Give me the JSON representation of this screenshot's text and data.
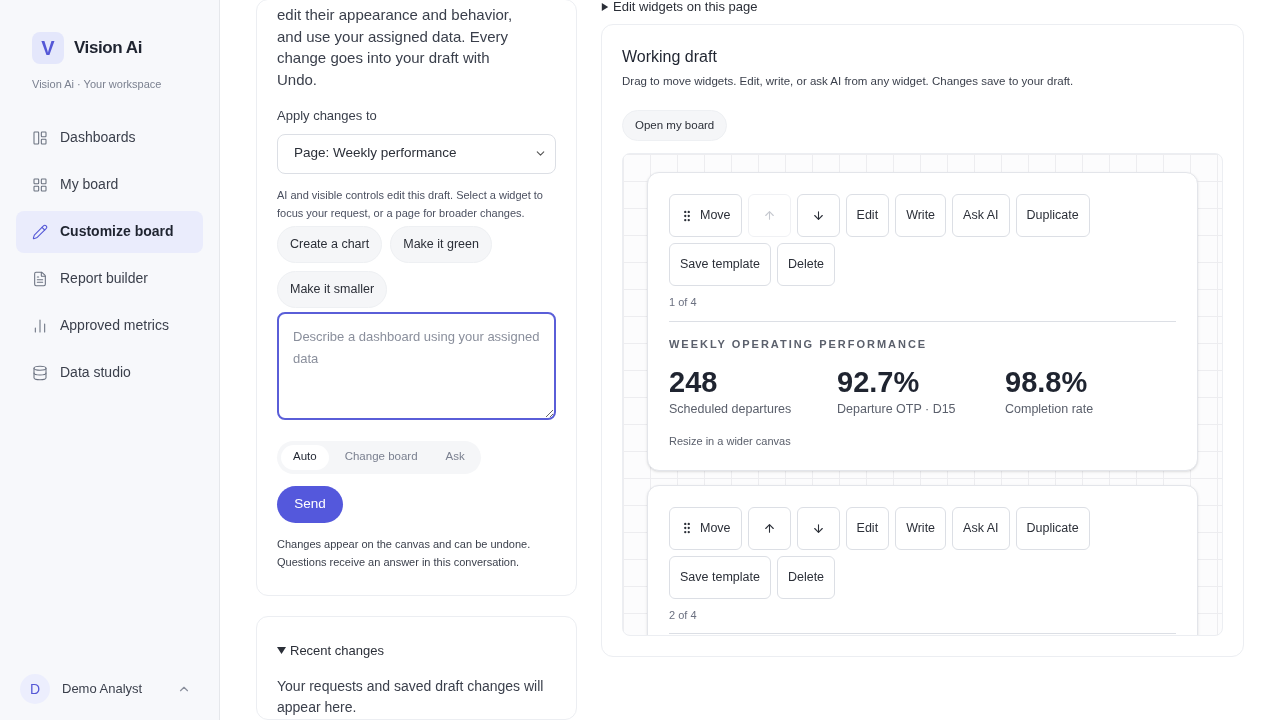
{
  "sidebar": {
    "brand": {
      "mark": "V",
      "name": "Vision Ai",
      "subtitle": "Vision Ai · Your workspace"
    },
    "nav": [
      {
        "label": "Dashboards",
        "selected": false
      },
      {
        "label": "My board",
        "selected": false
      },
      {
        "label": "Customize board",
        "selected": true
      },
      {
        "label": "Report builder",
        "selected": false
      },
      {
        "label": "Approved metrics",
        "selected": false
      },
      {
        "label": "Data studio",
        "selected": false
      }
    ],
    "user": {
      "initial": "D",
      "name": "Demo Analyst"
    }
  },
  "assistant": {
    "intro": "edit their appearance and behavior, and use your assigned data. Every change goes into your draft with Undo.",
    "apply_label": "Apply changes to",
    "scope": "Page: Weekly performance",
    "help": "AI and visible controls edit this draft. Select a widget to focus your request, or a page for broader changes.",
    "suggestions": [
      "Create a chart",
      "Make it green",
      "Make it smaller"
    ],
    "prompt": {
      "placeholder": "Describe a dashboard using your assigned data"
    },
    "modes": [
      {
        "label": "Auto",
        "selected": true
      },
      {
        "label": "Change board",
        "selected": false
      },
      {
        "label": "Ask",
        "selected": false
      }
    ],
    "send": "Send",
    "note": "Changes appear on the canvas and can be undone. Questions receive an answer in this conversation."
  },
  "recent": {
    "title": "Recent changes",
    "expanded": true,
    "text": "Your requests and saved draft changes will appear here."
  },
  "edit_widgets": {
    "title": "Edit widgets on this page",
    "expanded": false
  },
  "draft": {
    "title": "Working draft",
    "description": "Drag to move widgets. Edit, write, or ask AI from any widget. Changes save to your draft.",
    "open_button": "Open my board",
    "widgets": [
      {
        "toolbar": [
          {
            "kind": "move",
            "label": "Move",
            "disabled": false
          },
          {
            "kind": "up",
            "disabled": true
          },
          {
            "kind": "down",
            "disabled": false
          },
          {
            "kind": "text",
            "label": "Edit",
            "disabled": false
          },
          {
            "kind": "text",
            "label": "Write",
            "disabled": false
          },
          {
            "kind": "text",
            "label": "Ask AI",
            "disabled": false
          },
          {
            "kind": "text",
            "label": "Duplicate",
            "disabled": false
          },
          {
            "kind": "text",
            "label": "Save template",
            "disabled": false
          },
          {
            "kind": "text",
            "label": "Delete",
            "disabled": false
          }
        ],
        "position": "1 of 4",
        "title": "WEEKLY OPERATING PERFORMANCE",
        "metrics": [
          {
            "value": "248",
            "label": "Scheduled departures"
          },
          {
            "value": "92.7%",
            "label": "Departure OTP · D15"
          },
          {
            "value": "98.8%",
            "label": "Completion rate"
          }
        ],
        "footnote": "Resize in a wider canvas"
      },
      {
        "toolbar": [
          {
            "kind": "move",
            "label": "Move",
            "disabled": false
          },
          {
            "kind": "up",
            "disabled": false
          },
          {
            "kind": "down",
            "disabled": false
          },
          {
            "kind": "text",
            "label": "Edit",
            "disabled": false
          },
          {
            "kind": "text",
            "label": "Write",
            "disabled": false
          },
          {
            "kind": "text",
            "label": "Ask AI",
            "disabled": false
          },
          {
            "kind": "text",
            "label": "Duplicate",
            "disabled": false
          },
          {
            "kind": "text",
            "label": "Save template",
            "disabled": false
          },
          {
            "kind": "text",
            "label": "Delete",
            "disabled": false
          }
        ],
        "position": "2 of 4"
      }
    ]
  }
}
